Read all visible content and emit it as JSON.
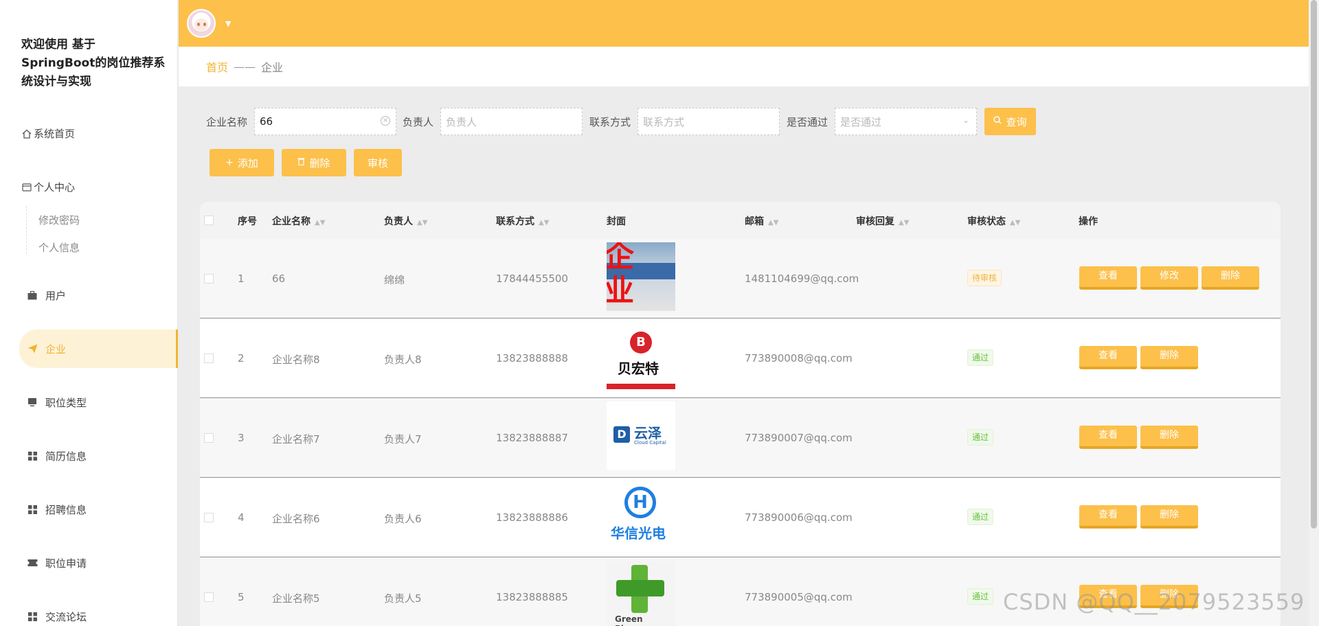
{
  "app": {
    "title": "欢迎使用 基于SpringBoot的岗位推荐系统设计与实现"
  },
  "sidebar": {
    "home": "系统首页",
    "personal_center": "个人中心",
    "sub_items": [
      "修改密码",
      "个人信息"
    ],
    "items": [
      {
        "label": "用户",
        "icon": "briefcase-icon"
      },
      {
        "label": "企业",
        "icon": "paper-plane-icon",
        "active": true
      },
      {
        "label": "职位类型",
        "icon": "monitor-icon"
      },
      {
        "label": "简历信息",
        "icon": "grid-icon"
      },
      {
        "label": "招聘信息",
        "icon": "grid-icon"
      },
      {
        "label": "职位申请",
        "icon": "ticket-icon"
      },
      {
        "label": "交流论坛",
        "icon": "grid-icon"
      }
    ]
  },
  "breadcrumb": {
    "home": "首页",
    "separator": "——",
    "current": "企业"
  },
  "search": {
    "company_label": "企业名称",
    "company_value": "66",
    "owner_label": "负责人",
    "owner_placeholder": "负责人",
    "contact_label": "联系方式",
    "contact_placeholder": "联系方式",
    "approved_label": "是否通过",
    "approved_placeholder": "是否通过",
    "query_button": "查询"
  },
  "actions": {
    "add": "添加",
    "delete": "删除",
    "review": "审核"
  },
  "table": {
    "headers": [
      "序号",
      "企业名称",
      "负责人",
      "联系方式",
      "封面",
      "邮箱",
      "审核回复",
      "审核状态",
      "操作"
    ],
    "rows": [
      {
        "no": "1",
        "name": "66",
        "owner": "绵绵",
        "phone": "17844455500",
        "cover": "企业",
        "email": "1481104699@qq.com",
        "status": "待审核",
        "status_type": "wait",
        "ops": [
          "查看",
          "修改",
          "删除"
        ]
      },
      {
        "no": "2",
        "name": "企业名称8",
        "owner": "负责人8",
        "phone": "13823888888",
        "cover": "贝宏特",
        "email": "773890008@qq.com",
        "status": "通过",
        "status_type": "pass",
        "ops": [
          "查看",
          "删除"
        ]
      },
      {
        "no": "3",
        "name": "企业名称7",
        "owner": "负责人7",
        "phone": "13823888887",
        "cover": "云泽",
        "cover_sub": "Cloud Capital",
        "email": "773890007@qq.com",
        "status": "通过",
        "status_type": "pass",
        "ops": [
          "查看",
          "删除"
        ]
      },
      {
        "no": "4",
        "name": "企业名称6",
        "owner": "负责人6",
        "phone": "13823888886",
        "cover": "华信光电",
        "email": "773890006@qq.com",
        "status": "通过",
        "status_type": "pass",
        "ops": [
          "查看",
          "删除"
        ]
      },
      {
        "no": "5",
        "name": "企业名称5",
        "owner": "负责人5",
        "phone": "13823888885",
        "cover": "Green Pharm",
        "email": "773890005@qq.com",
        "status": "通过",
        "status_type": "pass",
        "ops": [
          "查看",
          "删除"
        ]
      }
    ]
  },
  "colors": {
    "accent": "#fcc04b",
    "active_text": "#f3b331",
    "pass": "#67c23a"
  },
  "watermark": "CSDN @QQ__2079523559"
}
